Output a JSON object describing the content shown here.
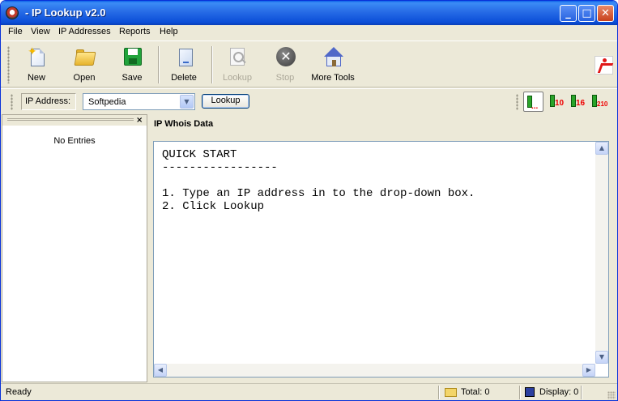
{
  "window": {
    "title": "- IP Lookup v2.0"
  },
  "title_buttons": {
    "minimize": "_",
    "maximize": "□",
    "close": "✕"
  },
  "menu": [
    "File",
    "View",
    "IP Addresses",
    "Reports",
    "Help"
  ],
  "toolbar": {
    "buttons": [
      {
        "label": "New",
        "icon": "new-document-icon",
        "enabled": true
      },
      {
        "label": "Open",
        "icon": "open-folder-icon",
        "enabled": true
      },
      {
        "label": "Save",
        "icon": "save-disk-icon",
        "enabled": true
      },
      {
        "label": "Delete",
        "icon": "delete-document-icon",
        "enabled": true
      },
      {
        "label": "Lookup",
        "icon": "magnifier-icon",
        "enabled": false
      },
      {
        "label": "Stop",
        "icon": "stop-icon",
        "enabled": false
      },
      {
        "label": "More Tools",
        "icon": "house-icon",
        "enabled": true
      }
    ],
    "exit_icon": "exit-running-man-icon"
  },
  "address_bar": {
    "label": "IP Address:",
    "value": "Softpedia",
    "lookup_button": "Lookup",
    "view_buttons": [
      {
        "icon": "bar-view-icon",
        "suffix": ""
      },
      {
        "icon": "bar-view-10-icon",
        "suffix": "10"
      },
      {
        "icon": "bar-view-16-icon",
        "suffix": "16"
      },
      {
        "icon": "bar-view-210-icon",
        "suffix": "210"
      }
    ]
  },
  "left_panel": {
    "close": "×",
    "empty_text": "No Entries"
  },
  "right_panel": {
    "title": "IP Whois Data",
    "content": "QUICK START\n-----------------\n\n1. Type an IP address in to the drop-down box.\n2. Click Lookup"
  },
  "status_bar": {
    "status": "Ready",
    "total": "Total: 0",
    "display": "Display: 0"
  },
  "colors": {
    "titlebar": "#0a5fe8",
    "window_bg": "#ece9d8",
    "accent_red": "#e00000"
  }
}
